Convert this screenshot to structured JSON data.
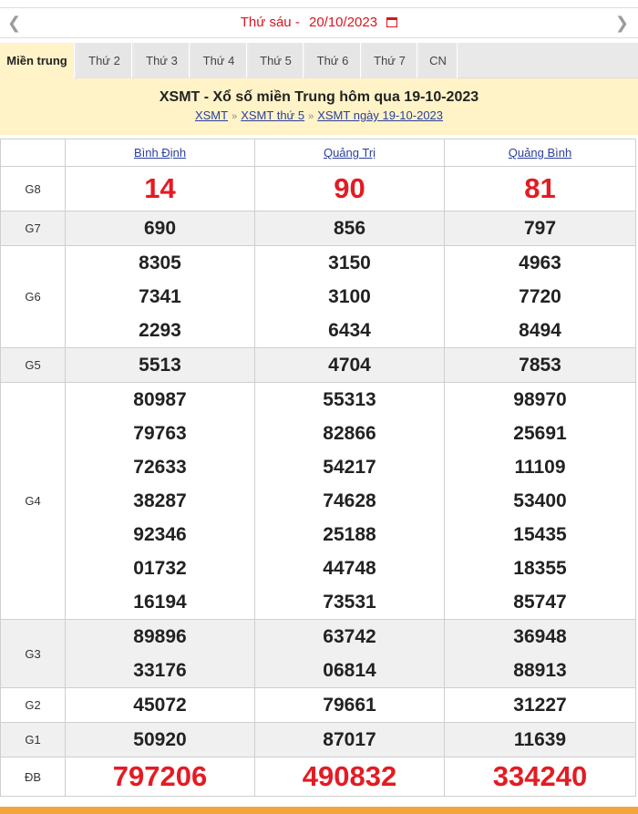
{
  "datebar": {
    "prev_icon": "chevron-left",
    "next_icon": "chevron-right",
    "day": "Thứ sáu -",
    "date": "20/10/2023",
    "calendar_icon": "calendar-icon"
  },
  "tabs": [
    {
      "label": "Miền trung",
      "active": true
    },
    {
      "label": "Thứ 2"
    },
    {
      "label": "Thứ 3"
    },
    {
      "label": "Thứ 4"
    },
    {
      "label": "Thứ 5"
    },
    {
      "label": "Thứ 6"
    },
    {
      "label": "Thứ 7"
    },
    {
      "label": "CN"
    }
  ],
  "heading": {
    "title": "XSMT - Xổ số miền Trung hôm qua 19-10-2023",
    "crumbs": [
      "XSMT",
      "XSMT thứ 5",
      "XSMT ngày 19-10-2023"
    ],
    "sep": "»"
  },
  "provinces": [
    "Bình Định",
    "Quảng Trị",
    "Quảng Bình"
  ],
  "prizes": [
    {
      "label": "G8",
      "values": [
        [
          "14"
        ],
        [
          "90"
        ],
        [
          "81"
        ]
      ]
    },
    {
      "label": "G7",
      "values": [
        [
          "690"
        ],
        [
          "856"
        ],
        [
          "797"
        ]
      ]
    },
    {
      "label": "G6",
      "values": [
        [
          "8305",
          "7341",
          "2293"
        ],
        [
          "3150",
          "3100",
          "6434"
        ],
        [
          "4963",
          "7720",
          "8494"
        ]
      ]
    },
    {
      "label": "G5",
      "values": [
        [
          "5513"
        ],
        [
          "4704"
        ],
        [
          "7853"
        ]
      ]
    },
    {
      "label": "G4",
      "values": [
        [
          "80987",
          "79763",
          "72633",
          "38287",
          "92346",
          "01732",
          "16194"
        ],
        [
          "55313",
          "82866",
          "54217",
          "74628",
          "25188",
          "44748",
          "73531"
        ],
        [
          "98970",
          "25691",
          "11109",
          "53400",
          "15435",
          "18355",
          "85747"
        ]
      ]
    },
    {
      "label": "G3",
      "values": [
        [
          "89896",
          "33176"
        ],
        [
          "63742",
          "06814"
        ],
        [
          "36948",
          "88913"
        ]
      ]
    },
    {
      "label": "G2",
      "values": [
        [
          "45072"
        ],
        [
          "79661"
        ],
        [
          "31227"
        ]
      ]
    },
    {
      "label": "G1",
      "values": [
        [
          "50920"
        ],
        [
          "87017"
        ],
        [
          "11639"
        ]
      ]
    },
    {
      "label": "ĐB",
      "values": [
        [
          "797206"
        ],
        [
          "490832"
        ],
        [
          "334240"
        ]
      ]
    }
  ],
  "colors": {
    "accent_red": "#e41b23",
    "tab_active_bg": "#fff3c7",
    "link_blue": "#2a3f9c"
  }
}
